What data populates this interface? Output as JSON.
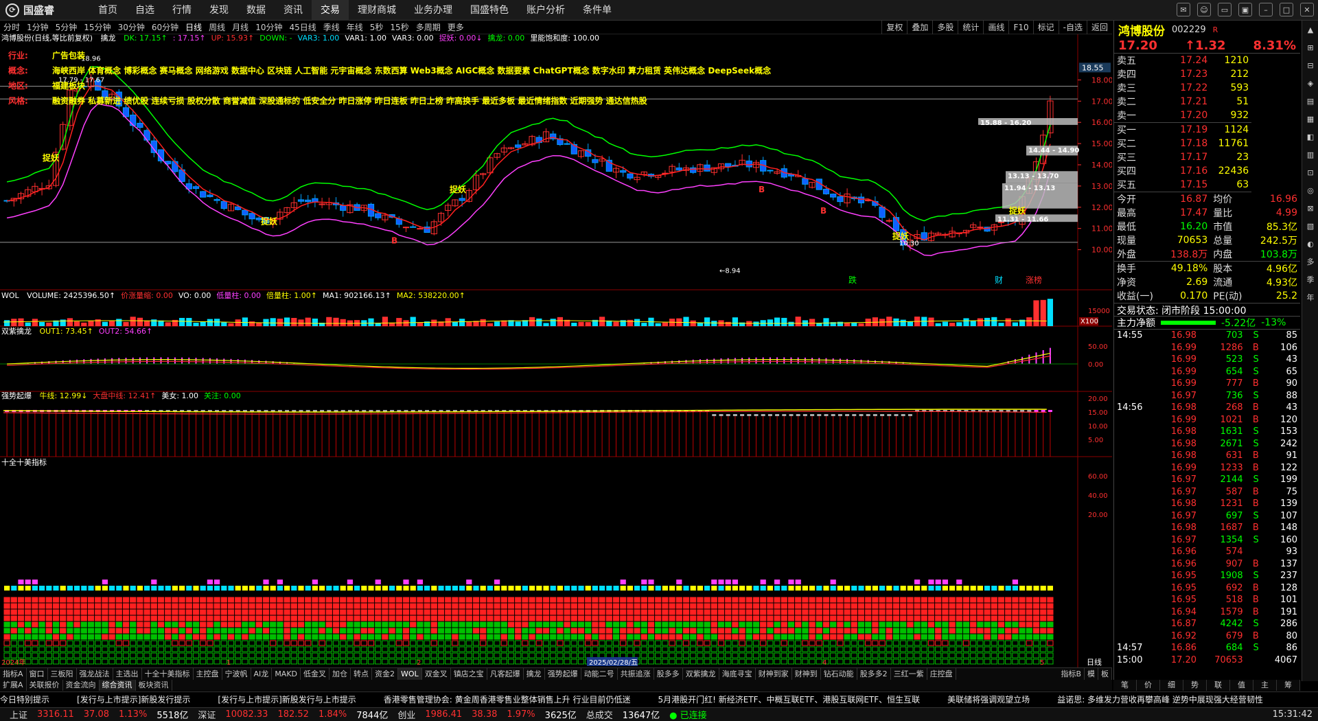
{
  "app": {
    "logo_text": "国盛睿"
  },
  "menu": [
    "首页",
    "自选",
    "行情",
    "发现",
    "数据",
    "资讯",
    "交易",
    "理财商城",
    "业务办理",
    "国盛特色",
    "账户分析",
    "条件单"
  ],
  "menu_active_index": 6,
  "periods": [
    "分时",
    "1分钟",
    "5分钟",
    "15分钟",
    "30分钟",
    "60分钟",
    "日线",
    "周线",
    "月线",
    "10分钟",
    "45日线",
    "季线",
    "年线",
    "5秒",
    "15秒",
    "多周期",
    "更多"
  ],
  "period_active_index": 6,
  "right_tools": [
    "复权",
    "叠加",
    "多股",
    "统计",
    "画线",
    "F10",
    "标记",
    "-自选",
    "返回"
  ],
  "main_panel": {
    "stock": "鸿博股份(日线,等比前复权)",
    "indicator_name": "擒龙",
    "vals": [
      "DK: 17.15↑",
      ": 17.15↑",
      "UP: 15.93↑",
      "DOWN: -",
      "VAR3: 1.00",
      "VAR1: 1.00",
      "VAR3: 0.00",
      "捉妖: 0.00↓",
      "擒龙: 0.00",
      "里能饱和度: 100.00"
    ],
    "concepts": [
      {
        "label": "行业:",
        "value": "广告包装"
      },
      {
        "label": "概念:",
        "value": "海峡西岸 体育概念 博彩概念 赛马概念 网络游戏 数据中心 区块链 人工智能 元宇宙概念 东数西算 Web3概念 AIGC概念 数据要素 ChatGPT概念 数字水印 算力租赁 英伟达概念 DeepSeek概念"
      },
      {
        "label": "地区:",
        "value": "福建板块"
      },
      {
        "label": "风格:",
        "value": "融资融券 私募新进 绩优股 连续亏损 股权分散 商誉减值 深股通标的 低安全分 昨日涨停 昨日连板 昨日上榜 昨高换手 最近多板 最近情绪指数 近期强势 通达信热股"
      }
    ],
    "price_ticks": [
      "18.55",
      "18.00",
      "17.00",
      "16.00",
      "15.00",
      "14.00",
      "13.00",
      "12.00",
      "11.00",
      "10.00"
    ],
    "annotations": {
      "high_label": "18.96",
      "range1": "17.79 - 17.67",
      "low_label": "8.94",
      "zone1": "15.88 - 16.20",
      "zone2": "14.44 - 14.90",
      "zone3": "13.13 - 13.70",
      "zone4": "11.94 - 13.13",
      "zone5": "11.31 - 11.66",
      "mid_label": "10.30",
      "tag_zhuoyao": "捉妖",
      "tag_b": "B",
      "marker_die": "跌",
      "marker_cai": "财",
      "marker_zhangting": "涨榜"
    }
  },
  "vol_panel": {
    "name": "WOL",
    "vals": [
      "VOLUME: 2425396.50↑",
      "价涨量缩: 0.00",
      "VO: 0.00",
      "低量柱: 0.00",
      "倍量柱: 1.00↑",
      "MA1: 902166.13↑",
      "MA2: 538220.00↑"
    ],
    "ticks": [
      "15000"
    ],
    "unit": "X100"
  },
  "sz_panel": {
    "name": "双紫擒龙",
    "vals": [
      "OUT1: 73.45↑",
      "OUT2: 54.66↑"
    ],
    "ticks": [
      "50.00",
      "0.00"
    ]
  },
  "qs_panel": {
    "name": "强势起爆",
    "vals": [
      "牛线: 12.99↓",
      "大盘中线: 12.41↑",
      "美女: 1.00",
      "关注: 0.00"
    ],
    "ticks": [
      "20.00",
      "15.00",
      "10.00",
      "5.00"
    ]
  },
  "sq_panel": {
    "name": "十全十美指标",
    "ticks": [
      "60.00",
      "40.00",
      "20.00"
    ]
  },
  "x_axis": {
    "year": "2024年",
    "m1": "1",
    "m2": "2",
    "date": "2025/02/28/五",
    "m4": "4",
    "m5": "5",
    "period_label": "日线"
  },
  "tabs": [
    "指标A",
    "窗口",
    "三板阳",
    "强龙战法",
    "主选出",
    "十全十美指标",
    "主控盘",
    "宁波帆",
    "AI龙",
    "MAKD",
    "低金叉",
    "加仓",
    "转点",
    "资金2",
    "WOL",
    "双金叉",
    "镇店之宝",
    "凡客起爆",
    "擒龙",
    "强势起爆",
    "动能二号",
    "共振追涨",
    "股多多",
    "双紫擒龙",
    "海底寻宝",
    "财神到家",
    "财神到",
    "钻石动能",
    "股多多2",
    "三红一紫",
    "庄控盘"
  ],
  "tabs_right": [
    "指标B",
    "模",
    "板"
  ],
  "tabs2": [
    "扩展A",
    "关联报价",
    "资金流向",
    "综合资讯",
    "板块资讯"
  ],
  "tabs2_active_index": 3,
  "quote": {
    "name": "鸿博股份",
    "code": "002229",
    "flag": "R",
    "price": "17.20",
    "change": "1.32",
    "pct": "8.31%",
    "asks": [
      {
        "label": "卖五",
        "price": "17.24",
        "vol": "1210"
      },
      {
        "label": "卖四",
        "price": "17.23",
        "vol": "212"
      },
      {
        "label": "卖三",
        "price": "17.22",
        "vol": "593"
      },
      {
        "label": "卖二",
        "price": "17.21",
        "vol": "51"
      },
      {
        "label": "卖一",
        "price": "17.20",
        "vol": "932"
      }
    ],
    "bids": [
      {
        "label": "买一",
        "price": "17.19",
        "vol": "1124"
      },
      {
        "label": "买二",
        "price": "17.18",
        "vol": "11761"
      },
      {
        "label": "买三",
        "price": "17.17",
        "vol": "23"
      },
      {
        "label": "买四",
        "price": "17.16",
        "vol": "22436"
      },
      {
        "label": "买五",
        "price": "17.15",
        "vol": "63"
      }
    ],
    "stats": [
      [
        "今开",
        "16.87",
        "均价",
        "16.96"
      ],
      [
        "最高",
        "17.47",
        "量比",
        "4.99"
      ],
      [
        "最低",
        "16.20",
        "市值",
        "85.3亿"
      ],
      [
        "现量",
        "70653",
        "总量",
        "242.5万"
      ],
      [
        "外盘",
        "138.8万",
        "内盘",
        "103.8万"
      ],
      [
        "换手",
        "49.18%",
        "股本",
        "4.96亿"
      ],
      [
        "净资",
        "2.69",
        "流通",
        "4.93亿"
      ],
      [
        "收益(一)",
        "0.170",
        "PE(动)",
        "25.2"
      ]
    ],
    "trade_state": "交易状态: 闭市阶段 15:00:00",
    "main_net_label": "主力净额",
    "main_net_val": "-5.22亿",
    "main_net_pct": "-13%",
    "ticks": [
      [
        "14:55",
        "16.98",
        "703",
        "S",
        "85"
      ],
      [
        "",
        "16.99",
        "1286",
        "B",
        "106"
      ],
      [
        "",
        "16.99",
        "523",
        "S",
        "43"
      ],
      [
        "",
        "16.99",
        "654",
        "S",
        "65"
      ],
      [
        "",
        "16.99",
        "777",
        "B",
        "90"
      ],
      [
        "",
        "16.97",
        "736",
        "S",
        "88"
      ],
      [
        "14:56",
        "16.98",
        "268",
        "B",
        "43"
      ],
      [
        "",
        "16.99",
        "1021",
        "B",
        "120"
      ],
      [
        "",
        "16.98",
        "1631",
        "S",
        "153"
      ],
      [
        "",
        "16.98",
        "2671",
        "S",
        "242"
      ],
      [
        "",
        "16.98",
        "631",
        "B",
        "91"
      ],
      [
        "",
        "16.99",
        "1233",
        "B",
        "122"
      ],
      [
        "",
        "16.97",
        "2144",
        "S",
        "199"
      ],
      [
        "",
        "16.97",
        "587",
        "B",
        "75"
      ],
      [
        "",
        "16.98",
        "1231",
        "B",
        "139"
      ],
      [
        "",
        "16.97",
        "697",
        "S",
        "107"
      ],
      [
        "",
        "16.98",
        "1687",
        "B",
        "148"
      ],
      [
        "",
        "16.97",
        "1354",
        "S",
        "160"
      ],
      [
        "",
        "16.96",
        "574",
        "",
        "93"
      ],
      [
        "",
        "16.96",
        "907",
        "B",
        "137"
      ],
      [
        "",
        "16.95",
        "1908",
        "S",
        "237"
      ],
      [
        "",
        "16.95",
        "692",
        "B",
        "128"
      ],
      [
        "",
        "16.95",
        "518",
        "B",
        "101"
      ],
      [
        "",
        "16.94",
        "1579",
        "B",
        "191"
      ],
      [
        "",
        "16.87",
        "4242",
        "S",
        "286"
      ],
      [
        "",
        "16.92",
        "679",
        "B",
        "80"
      ],
      [
        "14:57",
        "16.86",
        "684",
        "S",
        "86"
      ],
      [
        "15:00",
        "17.20",
        "70653",
        "",
        "4067"
      ]
    ],
    "tabs": [
      "笔",
      "价",
      "细",
      "势",
      "联",
      "值",
      "主",
      "筹"
    ]
  },
  "sidebar_right": [
    "多",
    "季",
    "年"
  ],
  "ticker": [
    "今日特别提示",
    "[发行与上市提示]新股发行提示",
    "[发行与上市提示]新股发行与上市提示",
    "香港零售管理协会: 黄金周香港零售业整体销售上升 行业目前仍低迷",
    "5月港股开门红! 新经济ETF、中概互联ETF、港股互联网ETF、恒生互联",
    "美联储将强调观望立场",
    "益诺思: 多维发力营收再攀高峰 逆势中展现强大经营韧性"
  ],
  "status": {
    "sh_label": "上证",
    "sh_val": "3316.11",
    "sh_chg": "37.08",
    "sh_pct": "1.13%",
    "sh_amt": "5518亿",
    "sz_label": "深证",
    "sz_val": "10082.33",
    "sz_chg": "182.52",
    "sz_pct": "1.84%",
    "sz_amt": "7844亿",
    "cy_label": "创业",
    "cy_val": "1986.41",
    "cy_chg": "38.38",
    "cy_pct": "1.97%",
    "cy_amt": "3625亿",
    "total_label": "总成交",
    "total_val": "13647亿",
    "conn": "已连接",
    "time": "15:31:42"
  }
}
